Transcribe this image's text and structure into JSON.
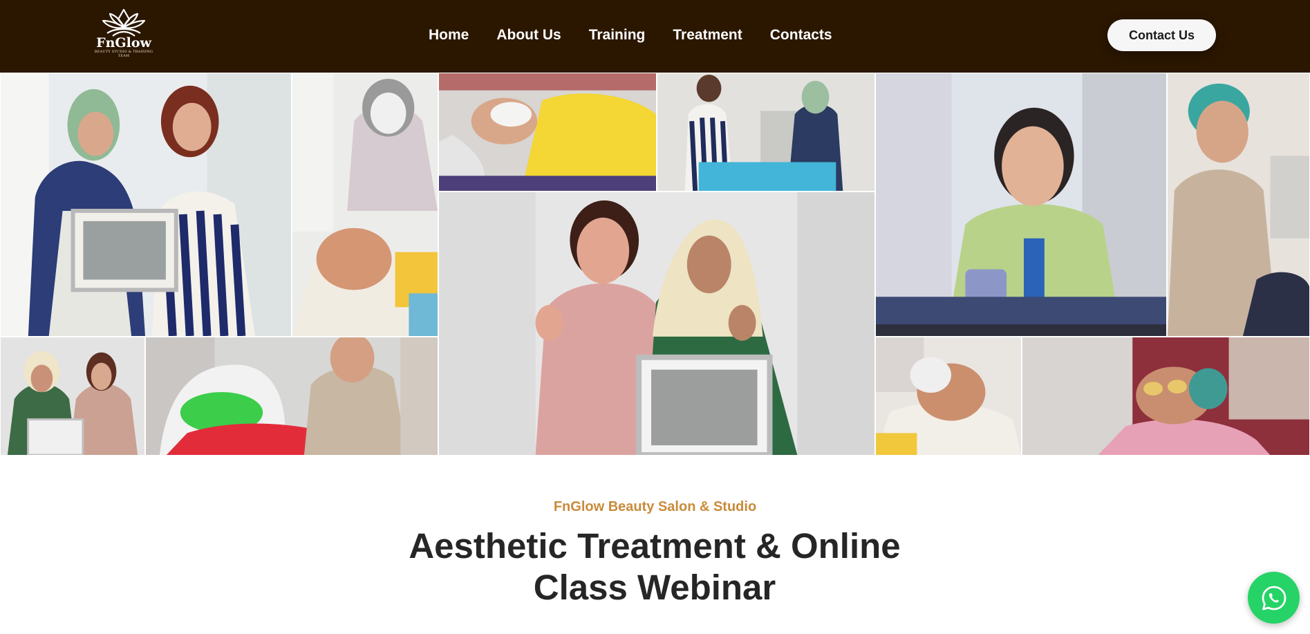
{
  "brand": {
    "name": "FnGlow",
    "tagline": "BEAUTY STUDIO & TRAINING TEAM"
  },
  "nav": {
    "items": [
      {
        "label": "Home"
      },
      {
        "label": "About Us"
      },
      {
        "label": "Training"
      },
      {
        "label": "Treatment"
      },
      {
        "label": "Contacts"
      }
    ],
    "cta_label": "Contact Us"
  },
  "hero": {
    "kicker": "FnGlow Beauty Salon & Studio",
    "headline": "Aesthetic Treatment & Online Class Webinar"
  },
  "collage": {
    "photos": [
      "Two women holding a framed certificate",
      "Practitioner performing facial treatment on smiling client",
      "Client receiving mask treatment under yellow towel",
      "Trainer and student at treatment bed",
      "Woman in green blazer on video call",
      "Practitioner in beige uniform",
      "Two women giving thumbs up with certificate",
      "Client under green LED light therapy",
      "Two women with certificate giving thumbs up",
      "Client smiling during facial treatment",
      "Client receiving eye treatment"
    ]
  },
  "icons": {
    "logo": "lotus-logo-icon",
    "whatsapp": "whatsapp-icon"
  },
  "colors": {
    "header_bg": "#2b1700",
    "accent": "#c98a3a",
    "headline": "#262626",
    "whatsapp": "#25d366"
  }
}
